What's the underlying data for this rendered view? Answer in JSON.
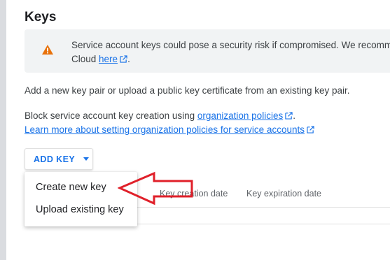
{
  "page": {
    "title": "Keys"
  },
  "warning": {
    "icon": "warning-icon",
    "line1": "Service account keys could pose a security risk if compromised. We recommen",
    "line2_prefix": "Cloud ",
    "link": "here",
    "line2_suffix": "."
  },
  "info": {
    "text": "Add a new key pair or upload a public key certificate from an existing key pair."
  },
  "block": {
    "prefix": "Block service account key creation using ",
    "link": "organization policies",
    "suffix": "."
  },
  "learn_more": {
    "link": "Learn more about setting organization policies for service accounts"
  },
  "add_key": {
    "label": "ADD KEY"
  },
  "menu": {
    "items": [
      {
        "label": "Create new key"
      },
      {
        "label": "Upload existing key"
      }
    ]
  },
  "table": {
    "columns": [
      "Key creation date",
      "Key expiration date"
    ]
  },
  "colors": {
    "accent": "#1a73e8",
    "warning": "#e8710a",
    "annotation_arrow": "#e0202a"
  }
}
